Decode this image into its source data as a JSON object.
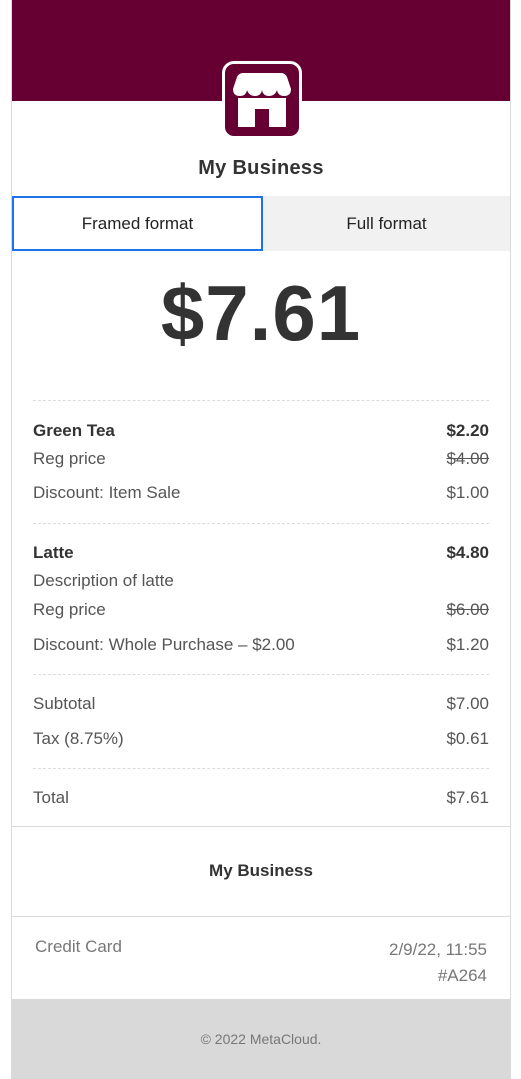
{
  "colors": {
    "brand": "#660033",
    "tab_active_border": "#1e73e8"
  },
  "header": {
    "logo_icon": "storefront-icon",
    "business_name": "My Business"
  },
  "tabs": [
    {
      "label": "Framed format",
      "active": true
    },
    {
      "label": "Full format",
      "active": false
    }
  ],
  "total_display": "$7.61",
  "items": [
    {
      "name": "Green Tea",
      "price": "$2.20",
      "reg_label": "Reg price",
      "reg_price": "$4.00",
      "discount_label": "Discount: Item Sale",
      "discount_amount": "$1.00"
    },
    {
      "name": "Latte",
      "price": "$4.80",
      "description": "Description of latte",
      "reg_label": "Reg price",
      "reg_price": "$6.00",
      "discount_label": "Discount: Whole Purchase – $2.00",
      "discount_amount": "$1.20"
    }
  ],
  "summary": {
    "subtotal_label": "Subtotal",
    "subtotal_value": "$7.00",
    "tax_label": "Tax (8.75%)",
    "tax_value": "$0.61",
    "total_label": "Total",
    "total_value": "$7.61"
  },
  "footer": {
    "business_name": "My Business",
    "payment_method": "Credit Card",
    "datetime": "2/9/22, 11:55",
    "order_id": "#A264",
    "copyright": "© 2022 MetaCloud."
  }
}
